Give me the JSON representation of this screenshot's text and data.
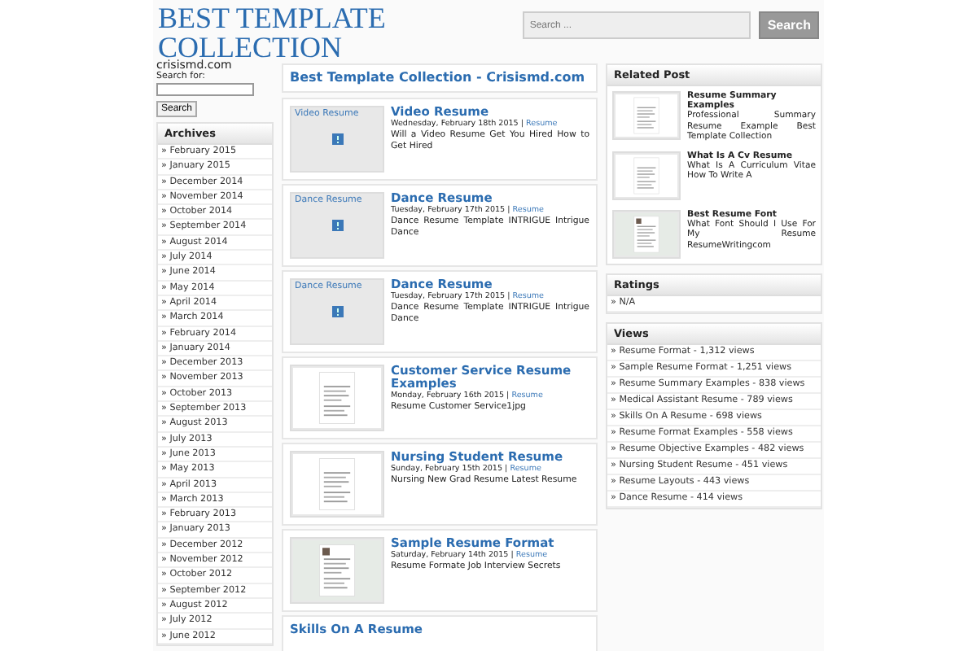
{
  "site": {
    "title": "BEST TEMPLATE COLLECTION",
    "tagline": "crisismd.com"
  },
  "header_search": {
    "placeholder": "Search ...",
    "button": "Search"
  },
  "sidebar_search": {
    "label": "Search for:",
    "button": "Search"
  },
  "archives": {
    "heading": "Archives",
    "items": [
      "» February 2015",
      "» January 2015",
      "» December 2014",
      "» November 2014",
      "» October 2014",
      "» September 2014",
      "» August 2014",
      "» July 2014",
      "» June 2014",
      "» May 2014",
      "» April 2014",
      "» March 2014",
      "» February 2014",
      "» January 2014",
      "» December 2013",
      "» November 2013",
      "» October 2013",
      "» September 2013",
      "» August 2013",
      "» July 2013",
      "» June 2013",
      "» May 2013",
      "» April 2013",
      "» March 2013",
      "» February 2013",
      "» January 2013",
      "» December 2012",
      "» November 2012",
      "» October 2012",
      "» September 2012",
      "» August 2012",
      "» July 2012",
      "» June 2012"
    ]
  },
  "main": {
    "heading": "Best Template Collection - Crisismd.com",
    "posts": [
      {
        "title": "Video Resume",
        "date": "Wednesday, February 18th 2015 |",
        "category": "Resume",
        "excerpt": "Will a Video Resume Get You Hired How to Get Hired",
        "thumb": {
          "kind": "broken",
          "alt": "Video Resume"
        }
      },
      {
        "title": "Dance Resume",
        "date": "Tuesday, February 17th 2015 |",
        "category": "Resume",
        "excerpt": "Dance Resume Template INTRIGUE Intrigue Dance",
        "thumb": {
          "kind": "broken",
          "alt": "Dance Resume"
        }
      },
      {
        "title": "Dance Resume",
        "date": "Tuesday, February 17th 2015 |",
        "category": "Resume",
        "excerpt": "Dance Resume Template INTRIGUE Intrigue Dance",
        "thumb": {
          "kind": "broken",
          "alt": "Dance Resume"
        }
      },
      {
        "title": "Customer Service Resume Examples",
        "date": "Monday, February 16th 2015 |",
        "category": "Resume",
        "excerpt": "Resume Customer Service1jpg",
        "thumb": {
          "kind": "document"
        }
      },
      {
        "title": "Nursing Student Resume",
        "date": "Sunday, February 15th 2015 |",
        "category": "Resume",
        "excerpt": "Nursing New Grad Resume Latest Resume",
        "thumb": {
          "kind": "document"
        }
      },
      {
        "title": "Sample Resume Format",
        "date": "Saturday, February 14th 2015 |",
        "category": "Resume",
        "excerpt": "Resume Formate Job Interview Secrets",
        "thumb": {
          "kind": "photo-document"
        }
      },
      {
        "title": "Skills On A Resume"
      }
    ]
  },
  "related": {
    "heading": "Related Post",
    "items": [
      {
        "title": "Resume Summary Examples",
        "text": "Professional Summary Resume Example Best Template Collection",
        "thumb": {
          "kind": "document"
        }
      },
      {
        "title": "What Is A Cv Resume",
        "text": "What Is A Curriculum Vitae How To Write A",
        "thumb": {
          "kind": "document"
        }
      },
      {
        "title": "Best Resume Font",
        "text": "What Font Should I Use For My Resume ResumeWritingcom",
        "thumb": {
          "kind": "photo-document"
        }
      }
    ]
  },
  "ratings": {
    "heading": "Ratings",
    "items": [
      "» N/A"
    ]
  },
  "views": {
    "heading": "Views",
    "items": [
      "» Resume Format - 1,312 views",
      "» Sample Resume Format - 1,251 views",
      "» Resume Summary Examples - 838 views",
      "» Medical Assistant Resume - 789 views",
      "» Skills On A Resume - 698 views",
      "» Resume Format Examples - 558 views",
      "» Resume Objective Examples - 482 views",
      "» Nursing Student Resume - 451 views",
      "» Resume Layouts - 443 views",
      "» Dance Resume - 414 views"
    ]
  }
}
